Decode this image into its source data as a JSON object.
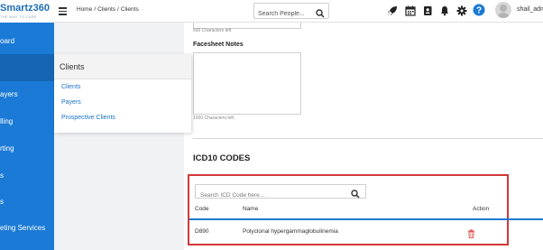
{
  "app": {
    "logo_text": "Smartz360",
    "logo_tagline": "THE WAY TO CARE"
  },
  "sidebar": {
    "items": [
      {
        "label": "oard"
      },
      {
        "label": "ayers"
      },
      {
        "label": "lling"
      },
      {
        "label": "rting"
      },
      {
        "label": "s"
      },
      {
        "label": "s"
      },
      {
        "label": "eting Services"
      }
    ]
  },
  "header": {
    "breadcrumb": [
      "Home",
      "Clients",
      "Clients"
    ],
    "breadcrumb_separator": "/",
    "search_placeholder": "Search People...",
    "username": "shail_admi",
    "icons": [
      "menu-icon",
      "rocket-icon",
      "calendar-icon",
      "contact-book-icon",
      "bell-icon",
      "gear-icon",
      "help-icon",
      "search-icon"
    ]
  },
  "main": {
    "chars_left_1": "500 Characters left",
    "facesheet_label": "Facesheet Notes",
    "chars_left_2": "1000 Characters left",
    "icd_title": "ICD10 CODES",
    "icd_search_placeholder": "Search ICD Code here...",
    "table": {
      "columns": [
        "Code",
        "Name",
        "Action"
      ],
      "rows": [
        {
          "code": "D890",
          "name": "Polyclonal hypergammaglobulinemia",
          "action_icon": "trash-icon"
        }
      ]
    }
  },
  "popup": {
    "title": "Clients",
    "items": [
      "Clients",
      "Payers",
      "Prospective Clients"
    ]
  },
  "colors": {
    "sidebar": "#1b7ad6",
    "link": "#1a73c9",
    "highlight_border": "#d0393a",
    "trash": "#e05a5a",
    "help": "#1b7ad6"
  }
}
